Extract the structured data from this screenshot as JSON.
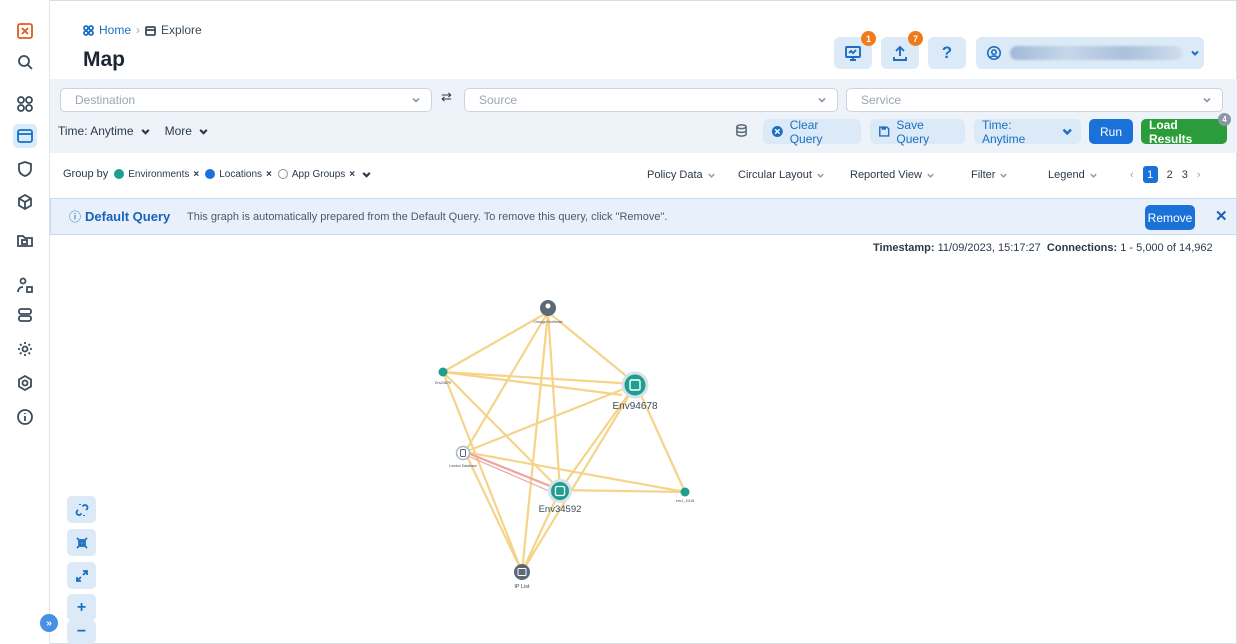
{
  "breadcrumb": {
    "home": "Home",
    "current": "Explore"
  },
  "page_title": "Map",
  "header": {
    "notify_badge": "1",
    "upload_badge": "7",
    "help_label": "?"
  },
  "query": {
    "destination_placeholder": "Destination",
    "source_placeholder": "Source",
    "service_placeholder": "Service",
    "time_label": "Time: Anytime",
    "more_label": "More",
    "clear_query": "Clear Query",
    "save_query": "Save Query",
    "time_button": "Time: Anytime",
    "run": "Run",
    "load_results": "Load Results",
    "load_badge": "4"
  },
  "groupby": {
    "label": "Group by",
    "chips": [
      {
        "label": "Environments",
        "color": "#1e9e8f"
      },
      {
        "label": "Locations",
        "color": "#1a72d9"
      },
      {
        "label": "App Groups",
        "color": "#8a97a5"
      }
    ]
  },
  "menus": {
    "policy_data": "Policy Data",
    "circular_layout": "Circular Layout",
    "reported_view": "Reported View",
    "filter": "Filter",
    "legend": "Legend"
  },
  "pager": {
    "current": "1",
    "p2": "2",
    "p3": "3"
  },
  "banner": {
    "title": "Default Query",
    "description": "This graph is automatically prepared from the Default Query. To remove this query, click \"Remove\".",
    "remove": "Remove"
  },
  "stats": {
    "timestamp_label": "Timestamp:",
    "timestamp": "11/09/2023, 15:17:27",
    "connections_label": "Connections:",
    "connections": "1 - 5,000 of 14,962"
  },
  "graph": {
    "nodes": {
      "location": "Chicago Northeast",
      "env_left": "Env24879",
      "env_main": "Env94678",
      "app_group": "London Database",
      "env_center": "Env34592",
      "env_right": "env1_11118",
      "ip_list": "IP List"
    }
  },
  "colors": {
    "accent": "#1a72d9",
    "success": "#2a9d3a",
    "badge": "#f07a1a",
    "edge": "#f5d48a",
    "edge_alert": "#eea3a3"
  }
}
